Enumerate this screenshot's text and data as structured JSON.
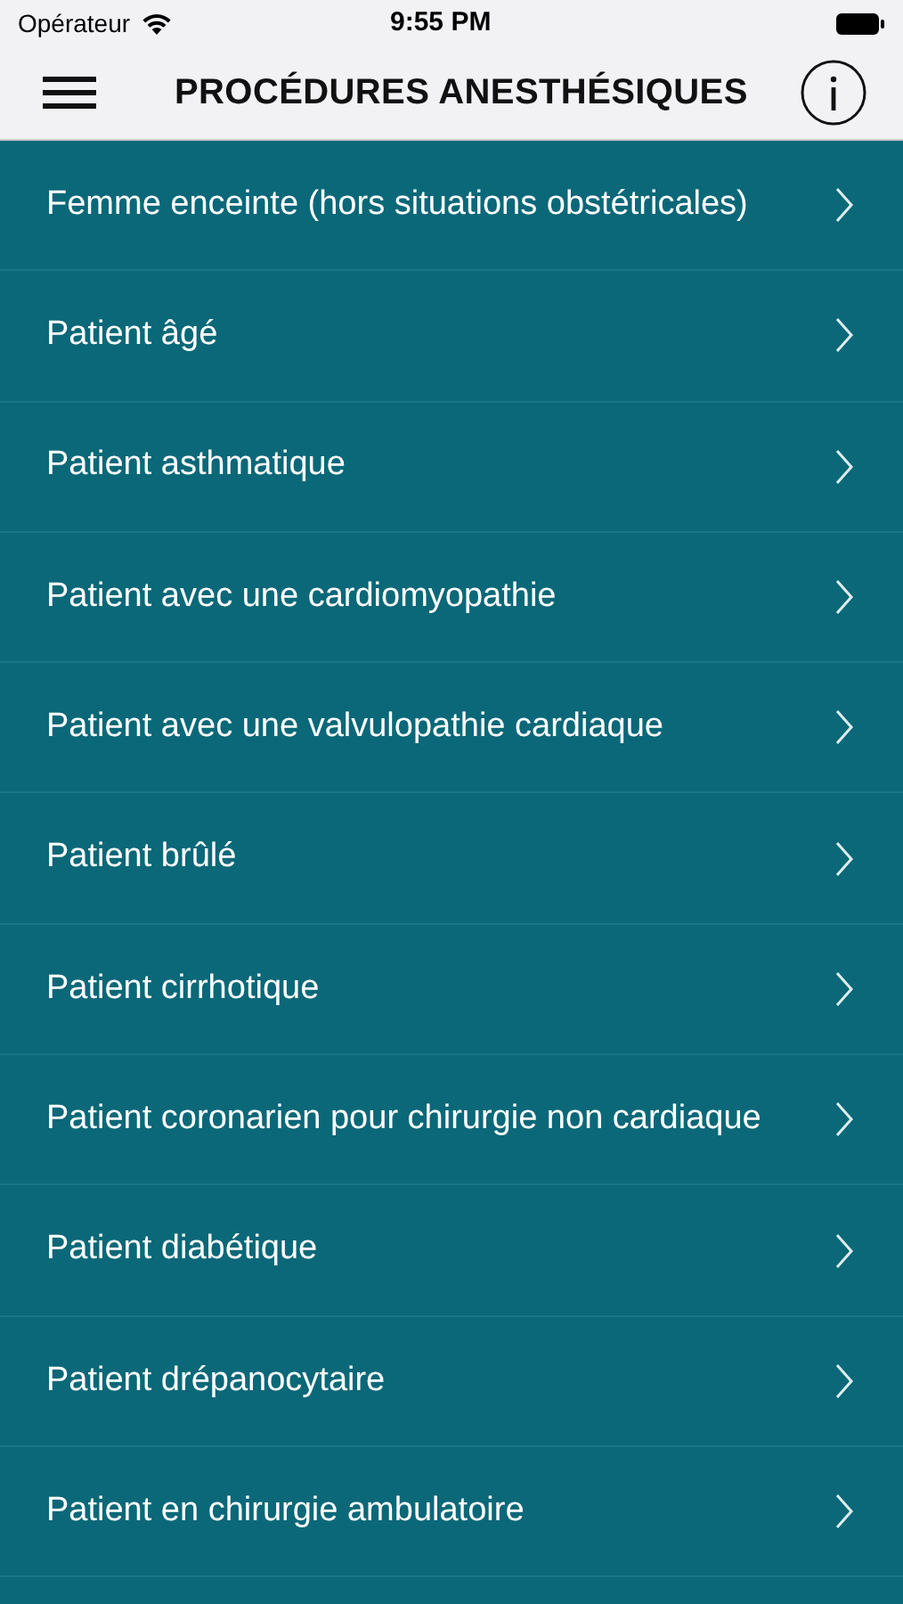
{
  "status_bar": {
    "carrier": "Opérateur",
    "time": "9:55 PM"
  },
  "header": {
    "title": "PROCÉDURES ANESTHÉSIQUES"
  },
  "list": {
    "items": [
      {
        "label": "Femme enceinte (hors situations obstétricales)"
      },
      {
        "label": "Patient âgé"
      },
      {
        "label": "Patient asthmatique"
      },
      {
        "label": "Patient avec une cardiomyopathie"
      },
      {
        "label": "Patient avec une valvulopathie cardiaque"
      },
      {
        "label": "Patient brûlé"
      },
      {
        "label": "Patient cirrhotique"
      },
      {
        "label": "Patient coronarien pour chirurgie non cardiaque"
      },
      {
        "label": "Patient diabétique"
      },
      {
        "label": "Patient drépanocytaire"
      },
      {
        "label": "Patient en chirurgie ambulatoire"
      }
    ]
  }
}
